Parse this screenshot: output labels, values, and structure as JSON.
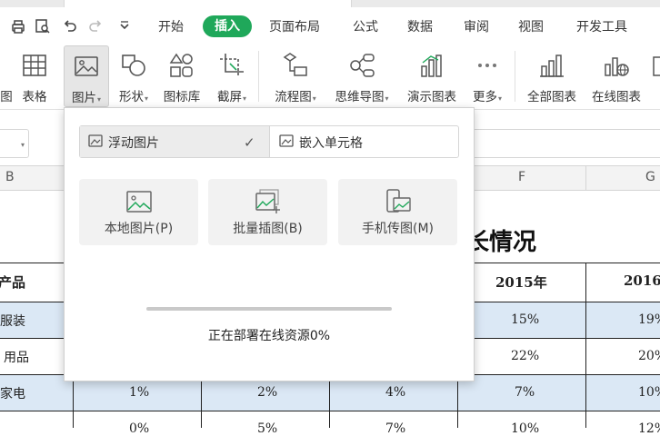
{
  "menubar": {
    "items": [
      "开始",
      "插入",
      "页面布局",
      "公式",
      "数据",
      "审阅",
      "视图",
      "开发工具"
    ],
    "active": "插入"
  },
  "ribbon": {
    "tools": [
      {
        "label": "图",
        "icon": "bar-chart-icon"
      },
      {
        "label": "表格",
        "icon": "table-icon"
      },
      {
        "label": "图片",
        "icon": "picture-icon",
        "dropdown": true,
        "pressed": true
      },
      {
        "label": "形状",
        "icon": "shapes-icon",
        "dropdown": true
      },
      {
        "label": "图标库",
        "icon": "icon-library-icon"
      },
      {
        "label": "截屏",
        "icon": "screenshot-icon",
        "dropdown": true
      },
      {
        "label": "流程图",
        "icon": "flowchart-icon",
        "dropdown": true
      },
      {
        "label": "思维导图",
        "icon": "mindmap-icon",
        "dropdown": true
      },
      {
        "label": "演示图表",
        "icon": "demo-chart-icon"
      },
      {
        "label": "更多",
        "icon": "more-icon",
        "dropdown": true
      },
      {
        "label": "全部图表",
        "icon": "all-charts-icon"
      },
      {
        "label": "在线图表",
        "icon": "online-chart-icon"
      }
    ]
  },
  "columns": [
    "B",
    "F",
    "G"
  ],
  "sheet": {
    "title_fragment": "长情况",
    "header_row": {
      "product": "产品",
      "y2015": "2015年",
      "y2016": "2016"
    },
    "rows": [
      {
        "name": "服装",
        "f": "15%",
        "g": "19%"
      },
      {
        "name": "用品",
        "f": "22%",
        "g": "20%"
      },
      {
        "name": "家电",
        "c": "1%",
        "d": "2%",
        "e": "4%",
        "f": "7%",
        "g": "10%"
      },
      {
        "name": "",
        "c": "0%",
        "d": "5%",
        "e": "7%",
        "f": "10%",
        "g": "12%"
      }
    ]
  },
  "popup": {
    "options": {
      "float": "浮动图片",
      "embed": "嵌入单元格"
    },
    "cards": [
      {
        "label": "本地图片(P)",
        "icon": "local-picture-icon"
      },
      {
        "label": "批量插图(B)",
        "icon": "batch-insert-icon"
      },
      {
        "label": "手机传图(M)",
        "icon": "phone-transfer-icon"
      }
    ],
    "status": "正在部署在线资源0%",
    "progress": 0
  }
}
